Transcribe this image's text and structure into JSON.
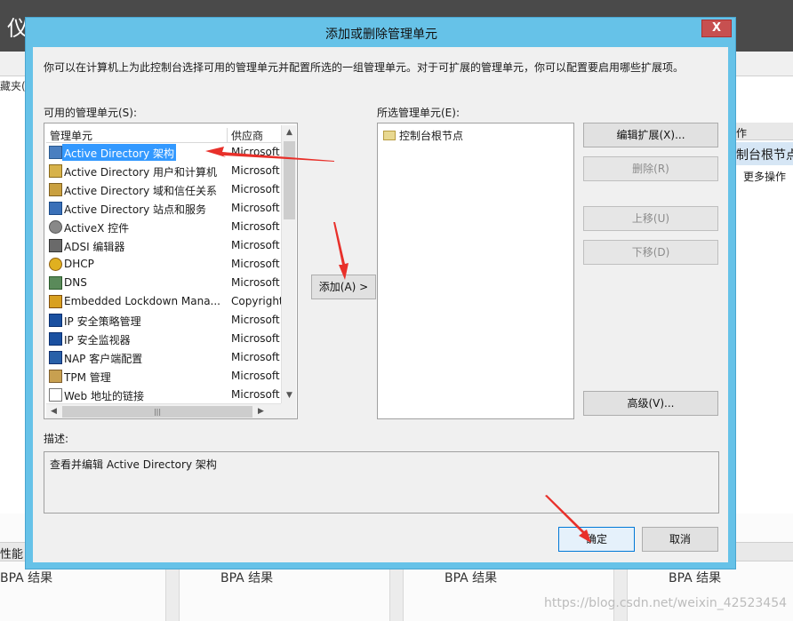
{
  "background": {
    "app_title": "仪表板",
    "favorites_label": "藏夹(",
    "right_pane_head": "作",
    "right_pane_row": "制台根节点",
    "right_pane_more": "更多操作",
    "perf_label": "性能",
    "bpa": [
      "BPA 结果",
      "BPA 结果",
      "BPA 结果",
      "BPA 结果"
    ],
    "watermark": "https://blog.csdn.net/weixin_42523454"
  },
  "dialog": {
    "title": "添加或删除管理单元",
    "close_label": "X",
    "intro": "你可以在计算机上为此控制台选择可用的管理单元并配置所选的一组管理单元。对于可扩展的管理单元，你可以配置要启用哪些扩展项。",
    "available_label": "可用的管理单元(S):",
    "selected_label": "所选管理单元(E):",
    "columns": {
      "name": "管理单元",
      "vendor": "供应商"
    },
    "snapins": [
      {
        "name": "Active Directory 架构",
        "vendor": "Microsoft",
        "icon": "ad-schema-icon"
      },
      {
        "name": "Active Directory 用户和计算机",
        "vendor": "Microsoft",
        "icon": "ad-users-icon"
      },
      {
        "name": "Active Directory 域和信任关系",
        "vendor": "Microsoft",
        "icon": "ad-trust-icon"
      },
      {
        "name": "Active Directory 站点和服务",
        "vendor": "Microsoft",
        "icon": "ad-sites-icon"
      },
      {
        "name": "ActiveX 控件",
        "vendor": "Microsoft",
        "icon": "activex-icon"
      },
      {
        "name": "ADSI 编辑器",
        "vendor": "Microsoft",
        "icon": "adsi-icon"
      },
      {
        "name": "DHCP",
        "vendor": "Microsoft",
        "icon": "dhcp-icon"
      },
      {
        "name": "DNS",
        "vendor": "Microsoft",
        "icon": "dns-icon"
      },
      {
        "name": "Embedded Lockdown Mana...",
        "vendor": "Copyright",
        "icon": "lockdown-icon"
      },
      {
        "name": "IP 安全策略管理",
        "vendor": "Microsoft",
        "icon": "ipsec-policy-icon"
      },
      {
        "name": "IP 安全监视器",
        "vendor": "Microsoft",
        "icon": "ipsec-monitor-icon"
      },
      {
        "name": "NAP 客户端配置",
        "vendor": "Microsoft",
        "icon": "nap-icon"
      },
      {
        "name": "TPM 管理",
        "vendor": "Microsoft",
        "icon": "tpm-icon"
      },
      {
        "name": "Web 地址的链接",
        "vendor": "Microsoft",
        "icon": "web-link-icon"
      }
    ],
    "selected_snapins": [
      "控制台根节点"
    ],
    "buttons": {
      "add": "添加(A) >",
      "edit_ext": "编辑扩展(X)...",
      "remove": "删除(R)",
      "move_up": "上移(U)",
      "move_down": "下移(D)",
      "advanced": "高级(V)...",
      "ok": "确定",
      "cancel": "取消"
    },
    "description_label": "描述:",
    "description": "查看并编辑 Active Directory 架构"
  }
}
